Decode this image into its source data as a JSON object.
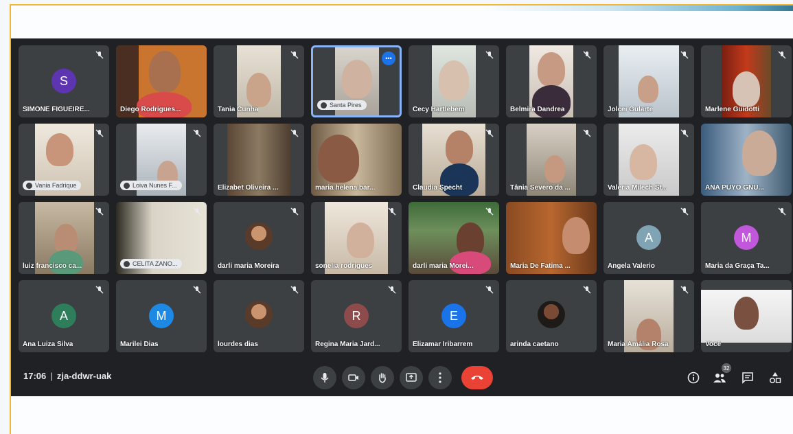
{
  "meeting": {
    "time": "17:06",
    "code": "zja-ddwr-uak",
    "participant_count": "32"
  },
  "tiles": [
    {
      "name": "SIMONE FIGUEIRE...",
      "initial": "S",
      "avatar_color": "#5e35b1"
    },
    {
      "name": "Diego Rodrigues..."
    },
    {
      "name": "Tania Cunha"
    },
    {
      "name": "Santa Pires",
      "status": "speaking"
    },
    {
      "name": "Cecy Hartlebem"
    },
    {
      "name": "Belmira Dandrea"
    },
    {
      "name": "Jolcei Gularte"
    },
    {
      "name": "Marlene Guidotti"
    },
    {
      "name": "Vania Fadrique"
    },
    {
      "name": "Loiva Nunes F..."
    },
    {
      "name": "Elizabet Oliveira ..."
    },
    {
      "name": "maria helena bar..."
    },
    {
      "name": "Claudia Specht"
    },
    {
      "name": "Tânia Severo da ..."
    },
    {
      "name": "Valeria Milech St..."
    },
    {
      "name": "ANA PUYO GNU..."
    },
    {
      "name": "luiz francisco ca..."
    },
    {
      "name": "CELITA ZANO..."
    },
    {
      "name": "darli maria Moreira"
    },
    {
      "name": "sonelia rodrigues"
    },
    {
      "name": "darli maria Morei..."
    },
    {
      "name": "Maria De Fatima ..."
    },
    {
      "name": "Angela Valerio",
      "initial": "A",
      "avatar_color": "#80a4b3"
    },
    {
      "name": "Maria da Graça Ta...",
      "initial": "M",
      "avatar_color": "#c158dc"
    },
    {
      "name": "Ana Luiza Silva",
      "initial": "A",
      "avatar_color": "#2e7d5b"
    },
    {
      "name": "Marilei Dias",
      "initial": "M",
      "avatar_color": "#1e88e5"
    },
    {
      "name": "lourdes dias"
    },
    {
      "name": "Regina Maria Jard...",
      "initial": "R",
      "avatar_color": "#8d4b4b"
    },
    {
      "name": "Elizamar Iribarrem",
      "initial": "E",
      "avatar_color": "#1a73e8"
    },
    {
      "name": "arinda caetano"
    },
    {
      "name": "Maria Amália Rosa"
    },
    {
      "name": "Você"
    }
  ]
}
